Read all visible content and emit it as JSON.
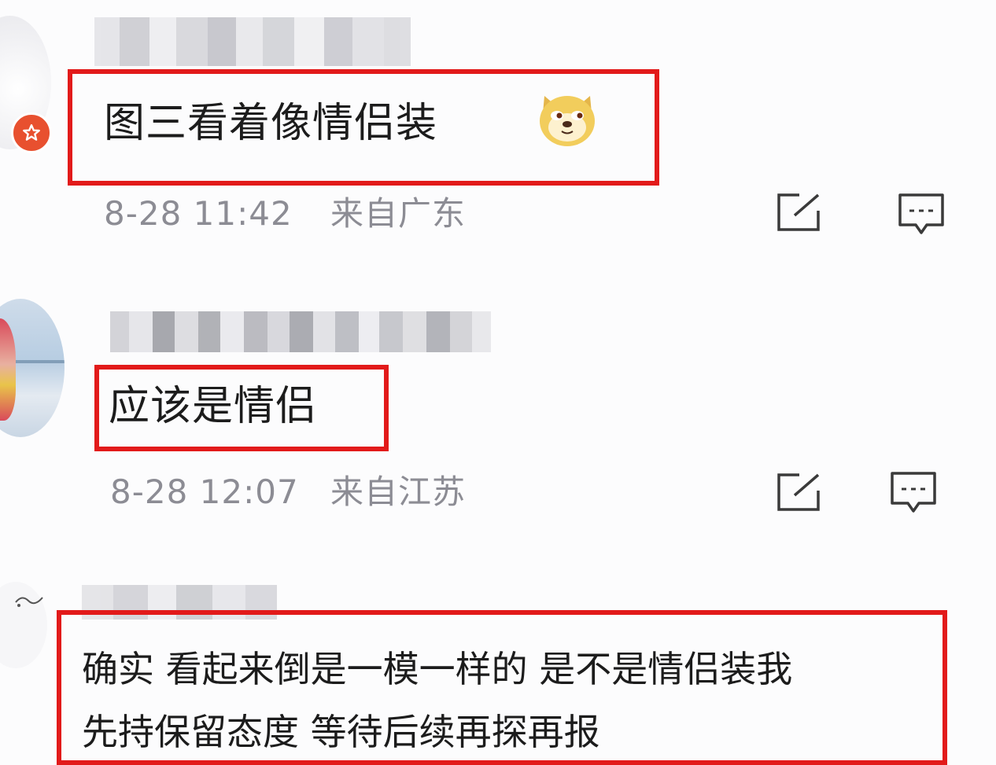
{
  "comments": [
    {
      "text": "图三看着像情侣装",
      "emoji": "doge-emoji",
      "time": "8-28 11:42",
      "location": "来自广东"
    },
    {
      "text": "应该是情侣",
      "time": "8-28 12:07",
      "location": "来自江苏"
    },
    {
      "line1": "确实 看起来倒是一模一样的 是不是情侣装我",
      "line2": "先持保留态度 等待后续再探再报"
    }
  ],
  "icons": {
    "share": "share-icon",
    "reply": "comment-icon",
    "badge": "star-badge-icon"
  },
  "colors": {
    "highlight": "#e21a1a",
    "meta_text": "#8c8c94",
    "badge": "#e8502f"
  }
}
